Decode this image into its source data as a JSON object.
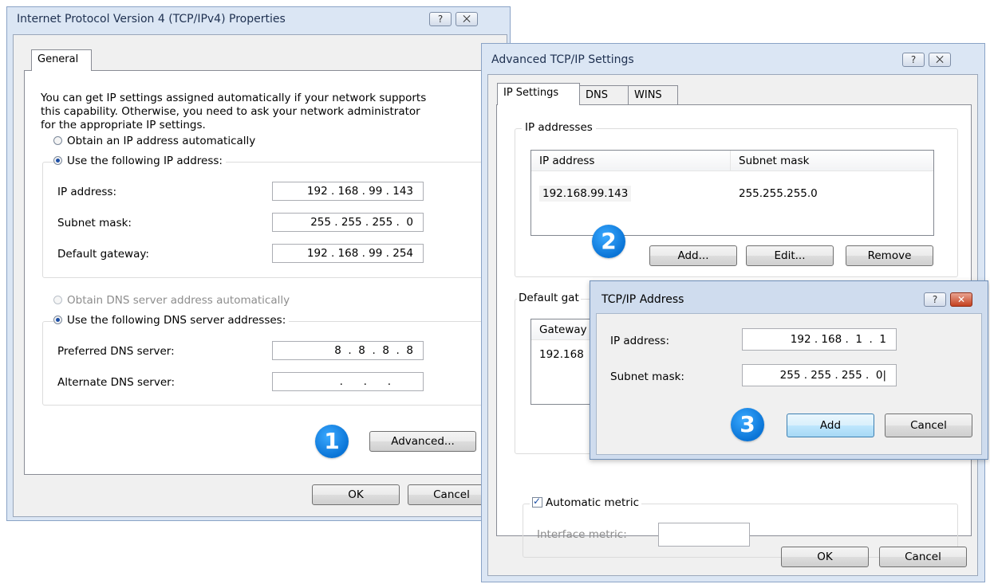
{
  "ipv4": {
    "title": "Internet Protocol Version 4 (TCP/IPv4) Properties",
    "help": "?",
    "close": "⨉",
    "tab_general": "General",
    "intro_line1": "You can get IP settings assigned automatically if your network supports",
    "intro_line2": "this capability. Otherwise, you need to ask your network administrator",
    "intro_line3": "for the appropriate IP settings.",
    "radio_auto_ip": "Obtain an IP address automatically",
    "radio_manual_ip": "Use the following IP address:",
    "ip_label": "IP address:",
    "ip_value": "192 . 168 . 99 . 143",
    "mask_label": "Subnet mask:",
    "mask_value": "255 . 255 . 255 .  0",
    "gw_label": "Default gateway:",
    "gw_value": "192 . 168 . 99 . 254",
    "radio_auto_dns": "Obtain DNS server address automatically",
    "radio_manual_dns": "Use the following DNS server addresses:",
    "pref_dns_label": "Preferred DNS server:",
    "pref_dns_value": "8  .  8  .  8  .  8",
    "alt_dns_label": "Alternate DNS server:",
    "alt_dns_value": ".      .      .",
    "advanced_button": "Advanced...",
    "ok_button": "OK",
    "cancel_button": "Cancel"
  },
  "advanced": {
    "title": "Advanced TCP/IP Settings",
    "help": "?",
    "close": "⨉",
    "tabs": [
      "IP Settings",
      "DNS",
      "WINS"
    ],
    "ip_group_label": "IP addresses",
    "col_ip": "IP address",
    "col_mask": "Subnet mask",
    "row_ip": "192.168.99.143",
    "row_mask": "255.255.255.0",
    "add_button": "Add...",
    "edit_button": "Edit...",
    "remove_button": "Remove",
    "gateway_group_label": "Default gat",
    "col_gateway": "Gateway",
    "row_gateway": "192.168",
    "auto_metric": "Automatic metric",
    "interface_metric": "Interface metric:",
    "ok_button": "OK",
    "cancel_button": "Cancel"
  },
  "tcpip_dialog": {
    "title": "TCP/IP Address",
    "help": "?",
    "close": "✕",
    "ip_label": "IP address:",
    "ip_value": "192 . 168 .  1  .  1",
    "mask_label": "Subnet mask:",
    "mask_value": "255 . 255 . 255 .  0|",
    "add_button": "Add",
    "cancel_button": "Cancel"
  },
  "badges": {
    "step1": "1",
    "step2": "2",
    "step3": "3"
  }
}
